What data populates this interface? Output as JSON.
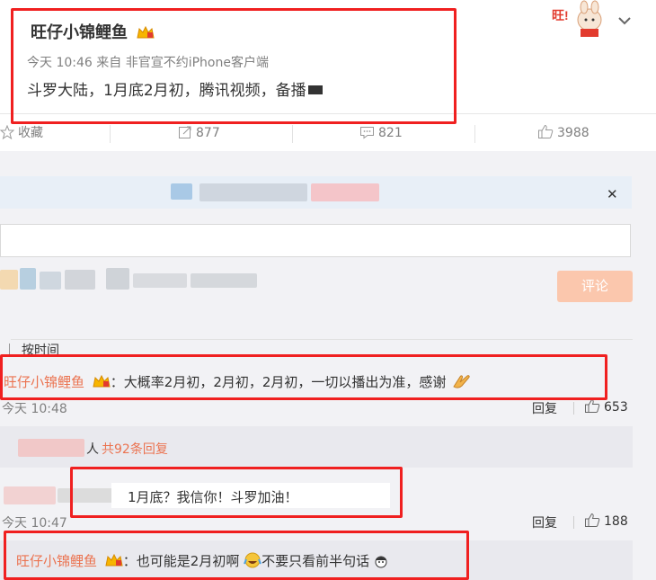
{
  "post": {
    "author": "旺仔小锦鲤鱼",
    "meta": "今天 10:46 来自 非官宣不约iPhone客户端",
    "text": "斗罗大陆，1月底2月初，腾讯视频，备播"
  },
  "actions": {
    "favorite": "收藏",
    "repost": "877",
    "comment": "821",
    "like": "3988"
  },
  "compose": {
    "submit": "评论"
  },
  "sort_label": "按时间",
  "comments": [
    {
      "author": "旺仔小锦鲤鱼",
      "text": "：大概率2月初，2月初，2月初，一切以播出为准，感谢",
      "time": "今天 10:48",
      "reply": "回复",
      "likes": "653",
      "replies_suffix": "人",
      "replies_link": "共92条回复"
    },
    {
      "text": "1月底？我信你！斗罗加油！",
      "time": "今天 10:47",
      "reply": "回复",
      "likes": "188"
    },
    {
      "author": "旺仔小锦鲤鱼",
      "text": "：也可能是2月初啊",
      "text2": "不要只看前半句话"
    }
  ],
  "colors": {
    "accent": "#eb7350",
    "highlight": "#f02020",
    "submit": "#fbc7ad",
    "panel": "#f2f2f5"
  },
  "icons": [
    "vip-crown-icon",
    "star-icon",
    "repost-icon",
    "comment-icon",
    "like-icon",
    "close-icon",
    "chevron-down-icon",
    "clap-hands-icon",
    "laugh-cry-emoji-icon",
    "face-emoji-icon"
  ]
}
